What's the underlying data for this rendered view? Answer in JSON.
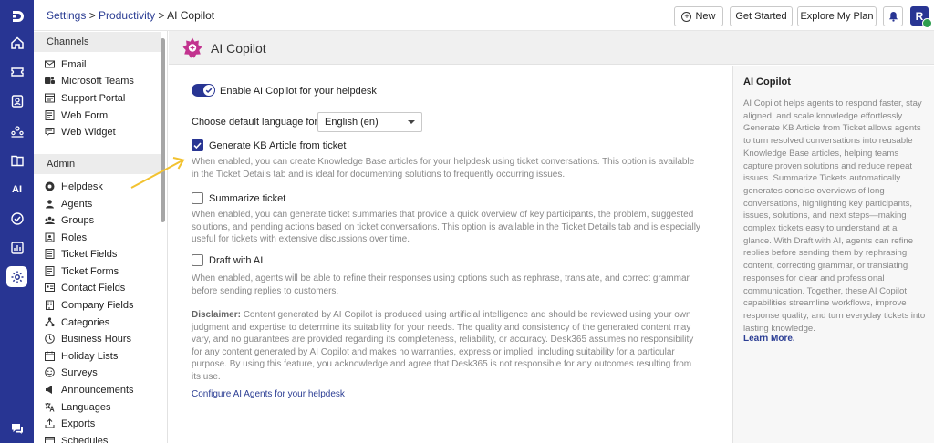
{
  "breadcrumb": {
    "settings": "Settings",
    "sep1": " > ",
    "productivity": "Productivity",
    "sep2": " > ",
    "current": "AI Copilot"
  },
  "topbar": {
    "new_label": "New",
    "get_started_label": "Get Started",
    "explore_plan_label": "Explore My Plan",
    "avatar_initial": "R"
  },
  "rail": {
    "icons": [
      "logo-icon",
      "home-icon",
      "tickets-icon",
      "contacts-icon",
      "org-icon",
      "knowledge-base-icon",
      "ai-icon",
      "tasks-icon",
      "reports-icon",
      "settings-icon",
      "chat-icon"
    ],
    "ai_text": "AI",
    "color": "#283593"
  },
  "sidebar": {
    "channels_heading": "Channels",
    "channels": [
      {
        "label": "Email",
        "icon": "email-icon"
      },
      {
        "label": "Microsoft Teams",
        "icon": "teams-icon"
      },
      {
        "label": "Support Portal",
        "icon": "portal-icon"
      },
      {
        "label": "Web Form",
        "icon": "form-icon"
      },
      {
        "label": "Web Widget",
        "icon": "widget-icon"
      }
    ],
    "admin_heading": "Admin",
    "admin": [
      {
        "label": "Helpdesk",
        "icon": "helpdesk-icon"
      },
      {
        "label": "Agents",
        "icon": "agents-icon"
      },
      {
        "label": "Groups",
        "icon": "groups-icon"
      },
      {
        "label": "Roles",
        "icon": "roles-icon"
      },
      {
        "label": "Ticket Fields",
        "icon": "ticket-fields-icon"
      },
      {
        "label": "Ticket Forms",
        "icon": "ticket-forms-icon"
      },
      {
        "label": "Contact Fields",
        "icon": "contact-fields-icon"
      },
      {
        "label": "Company Fields",
        "icon": "company-fields-icon"
      },
      {
        "label": "Categories",
        "icon": "categories-icon"
      },
      {
        "label": "Business Hours",
        "icon": "clock-icon"
      },
      {
        "label": "Holiday Lists",
        "icon": "calendar-icon"
      },
      {
        "label": "Surveys",
        "icon": "smiley-icon"
      },
      {
        "label": "Announcements",
        "icon": "megaphone-icon"
      },
      {
        "label": "Languages",
        "icon": "language-icon"
      },
      {
        "label": "Exports",
        "icon": "export-icon"
      },
      {
        "label": "Schedules",
        "icon": "schedule-icon"
      }
    ]
  },
  "header": {
    "title": "AI Copilot"
  },
  "content": {
    "enable_label": "Enable AI Copilot for your helpdesk",
    "enable_on": true,
    "language_label": "Choose default language for AI:",
    "language_value": "English (en)",
    "options": [
      {
        "label": "Generate KB Article from ticket",
        "checked": true,
        "desc": "When enabled, you can create Knowledge Base articles for your helpdesk using ticket conversations. This option is available in the Ticket Details tab and is ideal for documenting solutions to frequently occurring issues."
      },
      {
        "label": "Summarize ticket",
        "checked": false,
        "desc": "When enabled, you can generate ticket summaries that provide a quick overview of key participants, the problem, suggested solutions, and pending actions based on ticket conversations. This option is available in the Ticket Details tab and is especially useful for tickets with extensive discussions over time."
      },
      {
        "label": "Draft with AI",
        "checked": false,
        "desc": "When enabled, agents will be able to refine their responses using options such as rephrase, translate, and correct grammar before sending replies to customers."
      }
    ],
    "disclaimer_title": "Disclaimer:",
    "disclaimer_text": " Content generated by AI Copilot is produced using artificial intelligence and should be reviewed using your own judgment and expertise to determine its suitability for your needs. The quality and consistency of the generated content may vary, and no guarantees are provided regarding its completeness, reliability, or accuracy. Desk365 assumes no responsibility for any content generated by AI Copilot and makes no warranties, express or implied, including suitability for a particular purpose. By using this feature, you acknowledge and agree that Desk365 is not responsible for any outcomes resulting from its use.",
    "configure_link": "Configure AI Agents for your helpdesk"
  },
  "right_panel": {
    "title": "AI Copilot",
    "body": "AI Copilot helps agents to respond faster, stay aligned, and scale knowledge effortlessly. Generate KB Article from Ticket allows agents to turn resolved conversations into reusable Knowledge Base articles, helping teams capture proven solutions and reduce repeat issues. Summarize Tickets automatically generates concise overviews of long conversations, highlighting key participants, issues, solutions, and next steps—making complex tickets easy to understand at a glance. With Draft with AI, agents can refine replies before sending them by rephrasing content, correcting grammar, or translating responses for clear and professional communication. Together, these AI Copilot capabilities streamline workflows, improve response quality, and turn everyday tickets into lasting knowledge.",
    "learn_more": "Learn More."
  },
  "colors": {
    "brand": "#283593",
    "link": "#2c3e94",
    "annotation_arrow": "#f2c230",
    "logo": "#c2338f"
  }
}
